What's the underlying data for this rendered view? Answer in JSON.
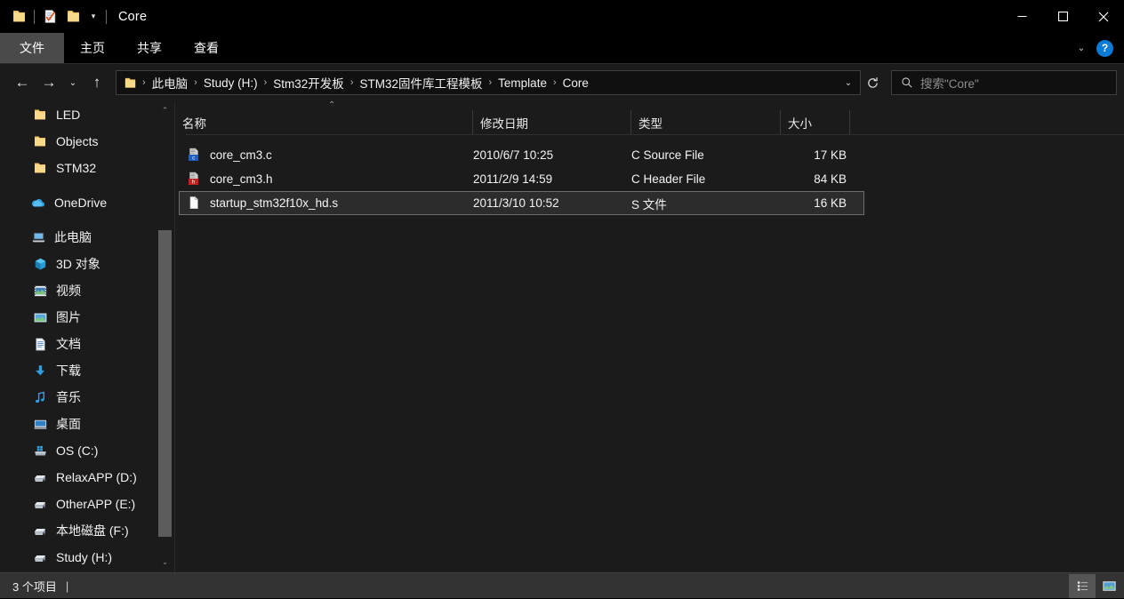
{
  "window": {
    "title": "Core",
    "quick_access": [
      {
        "name": "folder-icon",
        "label": "文件夹"
      },
      {
        "name": "properties-icon",
        "label": "属性"
      },
      {
        "name": "new-folder-icon",
        "label": "新建文件夹"
      }
    ],
    "quick_access_dropdown": "▾",
    "caption": {
      "minimize": "—",
      "maximize": "▢",
      "close": "✕"
    }
  },
  "ribbon": {
    "tabs": [
      {
        "label": "文件",
        "active": true
      },
      {
        "label": "主页",
        "active": false
      },
      {
        "label": "共享",
        "active": false
      },
      {
        "label": "查看",
        "active": false
      }
    ],
    "expand_chevron": "⌄",
    "help_label": "?"
  },
  "navbar": {
    "back": "←",
    "forward": "→",
    "recent": "⌄",
    "up": "↑",
    "folder_icon": "folder-icon",
    "breadcrumbs": [
      "此电脑",
      "Study (H:)",
      "Stm32开发板",
      "STM32固件库工程模板",
      "Template",
      "Core"
    ],
    "separator": "›",
    "history_chevron": "⌄",
    "refresh": "↻"
  },
  "search": {
    "placeholder": "搜索\"Core\"",
    "icon": "search-icon"
  },
  "sidebar": {
    "groups": [
      {
        "items": [
          {
            "label": "LED",
            "icon": "folder-icon",
            "type": "folder"
          },
          {
            "label": "Objects",
            "icon": "folder-icon",
            "type": "folder"
          },
          {
            "label": "STM32",
            "icon": "folder-icon",
            "type": "folder"
          }
        ]
      },
      {
        "items": [
          {
            "label": "OneDrive",
            "icon": "onedrive-icon",
            "type": "cloud"
          }
        ]
      },
      {
        "items": [
          {
            "label": "此电脑",
            "icon": "this-pc-icon",
            "type": "pc"
          },
          {
            "label": "3D 对象",
            "icon": "3d-objects-icon",
            "type": "library"
          },
          {
            "label": "视频",
            "icon": "videos-icon",
            "type": "library"
          },
          {
            "label": "图片",
            "icon": "pictures-icon",
            "type": "library"
          },
          {
            "label": "文档",
            "icon": "documents-icon",
            "type": "library"
          },
          {
            "label": "下载",
            "icon": "downloads-icon",
            "type": "library"
          },
          {
            "label": "音乐",
            "icon": "music-icon",
            "type": "library"
          },
          {
            "label": "桌面",
            "icon": "desktop-icon",
            "type": "library"
          },
          {
            "label": "OS (C:)",
            "icon": "system-drive-icon",
            "type": "drive"
          },
          {
            "label": "RelaxAPP (D:)",
            "icon": "drive-icon",
            "type": "drive"
          },
          {
            "label": "OtherAPP (E:)",
            "icon": "drive-icon",
            "type": "drive"
          },
          {
            "label": "本地磁盘 (F:)",
            "icon": "drive-icon",
            "type": "drive"
          },
          {
            "label": "Study (H:)",
            "icon": "drive-icon",
            "type": "drive"
          }
        ]
      }
    ],
    "scrollbar": {
      "up_arrow": "⌃",
      "down_arrow": "⌄"
    }
  },
  "filelist": {
    "sort_caret": "⌃",
    "columns": [
      {
        "label": "名称",
        "key": "name"
      },
      {
        "label": "修改日期",
        "key": "date"
      },
      {
        "label": "类型",
        "key": "type"
      },
      {
        "label": "大小",
        "key": "size"
      }
    ],
    "rows": [
      {
        "name": "core_cm3.c",
        "date": "2010/6/7 10:25",
        "type": "C Source File",
        "size": "17 KB",
        "icon": "c-source-file-icon",
        "selected": false
      },
      {
        "name": "core_cm3.h",
        "date": "2011/2/9 14:59",
        "type": "C Header File",
        "size": "84 KB",
        "icon": "c-header-file-icon",
        "selected": false
      },
      {
        "name": "startup_stm32f10x_hd.s",
        "date": "2011/3/10 10:52",
        "type": "S 文件",
        "size": "16 KB",
        "icon": "generic-file-icon",
        "selected": true
      }
    ]
  },
  "statusbar": {
    "item_count": "3 个项目",
    "separator": "|",
    "views": [
      {
        "name": "details-view-button",
        "active": true
      },
      {
        "name": "large-icons-view-button",
        "active": false
      }
    ]
  },
  "colors": {
    "accent_blue": "#0a7bd6",
    "folder_yellow": "#f6d07a",
    "selected_row_bg": "#2c2c2c",
    "title_bg": "#000000",
    "pane_bg": "#1b1b1b",
    "statusbar_bg": "#333333"
  }
}
